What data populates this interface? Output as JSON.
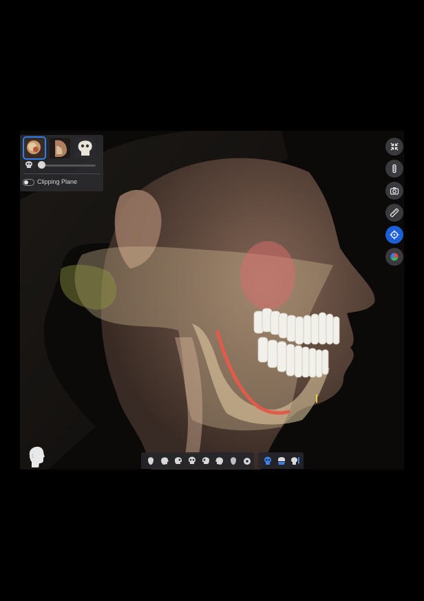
{
  "viewer": {
    "clipping_plane_label": "Clipping Plane"
  },
  "thumbnails": [
    {
      "name": "face-with-skull",
      "selected": true
    },
    {
      "name": "face-side",
      "selected": false
    },
    {
      "name": "skull-only",
      "selected": false
    }
  ],
  "opacity_slider": {
    "value": 0
  },
  "toolbar_right": [
    "collapse-icon",
    "implant-icon",
    "camera-icon",
    "ruler-icon",
    "crosshair-icon",
    "color-wheel-icon"
  ],
  "active_tool": "crosshair-icon",
  "colors": {
    "accent": "#1d5fd6",
    "panel": "#2a2a2e"
  }
}
